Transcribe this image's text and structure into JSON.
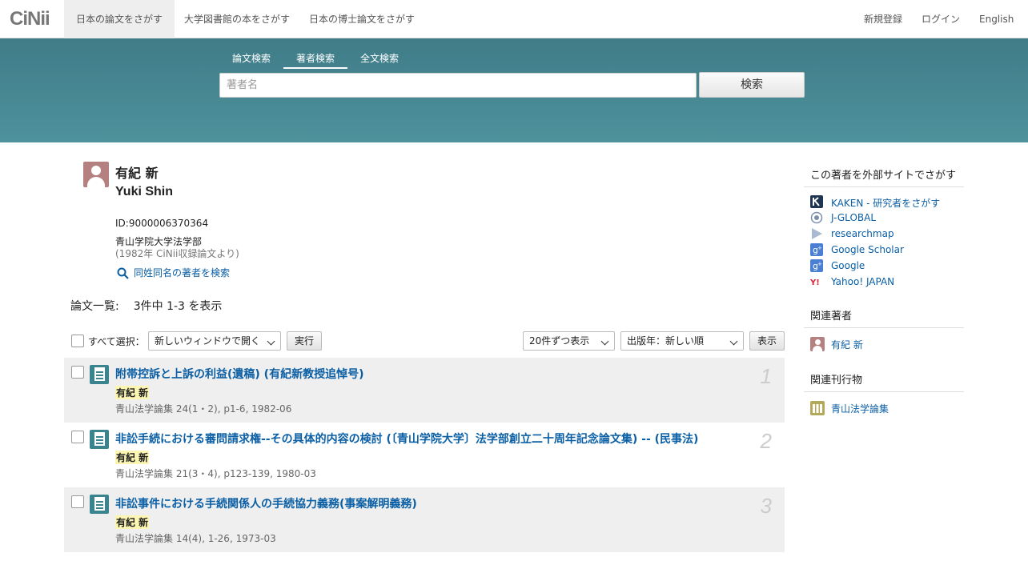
{
  "logo": "CiNii",
  "nav": {
    "tabs": [
      "日本の論文をさがす",
      "大学図書館の本をさがす",
      "日本の博士論文をさがす"
    ],
    "register": "新規登録",
    "login": "ログイン",
    "language": "English"
  },
  "search": {
    "tabs": [
      "論文検索",
      "著者検索",
      "全文検索"
    ],
    "active_tab": "著者検索",
    "placeholder": "著者名",
    "button": "検索"
  },
  "author": {
    "name_ja": "有紀 新",
    "name_en": "Yuki Shin",
    "id": "ID:9000006370364",
    "affiliation": "青山学院大学法学部",
    "affiliation_note": "(1982年 CiNii収録論文より)",
    "same_name_link": "同姓同名の著者を検索"
  },
  "list": {
    "label": "論文一覧:",
    "count": "3件中 1-3 を表示"
  },
  "toolbar": {
    "select_all": "すべて選択：",
    "open_option": "新しいウィンドウで開く",
    "execute": "実行",
    "per_page": "20件ずつ表示",
    "sort": "出版年：新しい順",
    "display": "表示"
  },
  "results": [
    {
      "title": "附帯控訴と上訴の利益(遺稿) (有紀新教授追悼号)",
      "author": "有紀 新",
      "meta": "青山法学論集 24(1・2), p1-6, 1982-06",
      "num": "1"
    },
    {
      "title": "非訟手続における審問請求権--その具体的内容の検討 (〔青山学院大学〕法学部創立二十周年記念論文集) -- (民事法)",
      "author": "有紀 新",
      "meta": "青山法学論集 21(3・4), p123-139, 1980-03",
      "num": "2"
    },
    {
      "title": "非訟事件における手続関係人の手続協力義務(事案解明義務)",
      "author": "有紀 新",
      "meta": "青山法学論集 14(4), 1-26, 1973-03",
      "num": "3"
    }
  ],
  "sidebar": {
    "external_heading": "この著者を外部サイトでさがす",
    "external_links": [
      "KAKEN - 研究者をさがす",
      "J-GLOBAL",
      "researchmap",
      "Google Scholar",
      "Google",
      "Yahoo! JAPAN"
    ],
    "related_authors_heading": "関連著者",
    "related_authors": [
      "有紀 新"
    ],
    "related_pubs_heading": "関連刊行物",
    "related_pubs": [
      "青山法学論集"
    ]
  },
  "colors": {
    "band": "#4a8a95",
    "link": "#0b5fa5",
    "avatar": "#b58080"
  }
}
